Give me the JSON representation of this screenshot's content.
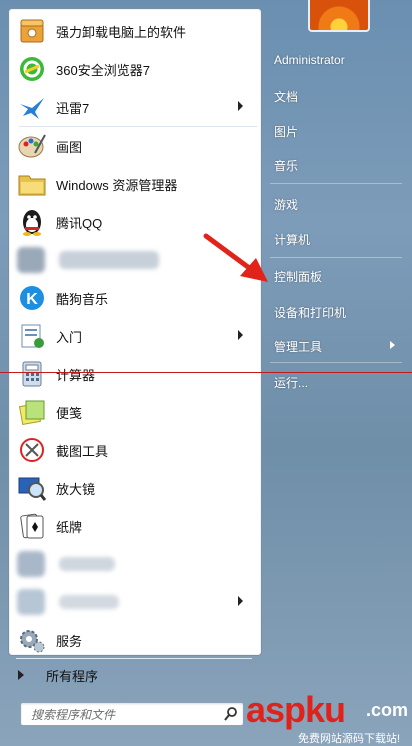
{
  "left_pane": {
    "items": [
      {
        "label": "强力卸载电脑上的软件",
        "icon": "uninstall-box-icon",
        "arrow": false
      },
      {
        "label": "360安全浏览器7",
        "icon": "360-browser-icon",
        "arrow": false
      },
      {
        "label": "迅雷7",
        "icon": "thunder-bird-icon",
        "arrow": true
      },
      {
        "label": "画图",
        "icon": "paint-palette-icon",
        "arrow": false
      },
      {
        "label": "Windows 资源管理器",
        "icon": "folder-icon",
        "arrow": false
      },
      {
        "label": "腾讯QQ",
        "icon": "qq-penguin-icon",
        "arrow": false
      },
      {
        "label": "",
        "icon": "blurred-app-icon",
        "arrow": false
      },
      {
        "label": "酷狗音乐",
        "icon": "kugou-k-icon",
        "arrow": false
      },
      {
        "label": "入门",
        "icon": "getting-started-icon",
        "arrow": true
      },
      {
        "label": "计算器",
        "icon": "calculator-icon",
        "arrow": false
      },
      {
        "label": "便笺",
        "icon": "sticky-notes-icon",
        "arrow": false
      },
      {
        "label": "截图工具",
        "icon": "snipping-tool-icon",
        "arrow": false
      },
      {
        "label": "放大镜",
        "icon": "magnifier-icon",
        "arrow": false
      },
      {
        "label": "纸牌",
        "icon": "solitaire-cards-icon",
        "arrow": false
      },
      {
        "label": "",
        "icon": "blurred-app-icon",
        "arrow": false
      },
      {
        "label": "",
        "icon": "blurred-app-icon",
        "arrow": true
      },
      {
        "label": "服务",
        "icon": "services-gear-icon",
        "arrow": false
      }
    ],
    "all_programs": "所有程序",
    "search": {
      "placeholder": "搜索程序和文件"
    }
  },
  "right_pane": {
    "user": "Administrator",
    "items": [
      {
        "label": "文档"
      },
      {
        "label": "图片"
      },
      {
        "label": "音乐"
      },
      {
        "label": "游戏"
      },
      {
        "label": "计算机"
      },
      {
        "label": "控制面板"
      },
      {
        "label": "设备和打印机"
      },
      {
        "label": "管理工具",
        "arrow": true
      },
      {
        "label": "运行..."
      }
    ]
  },
  "watermark": {
    "logo": "aspku",
    "domain": ".com",
    "tagline": "免费网站源码下载站!"
  },
  "colors": {
    "annotation_red": "#e2231a",
    "menu_border": "#7c8ea3"
  }
}
